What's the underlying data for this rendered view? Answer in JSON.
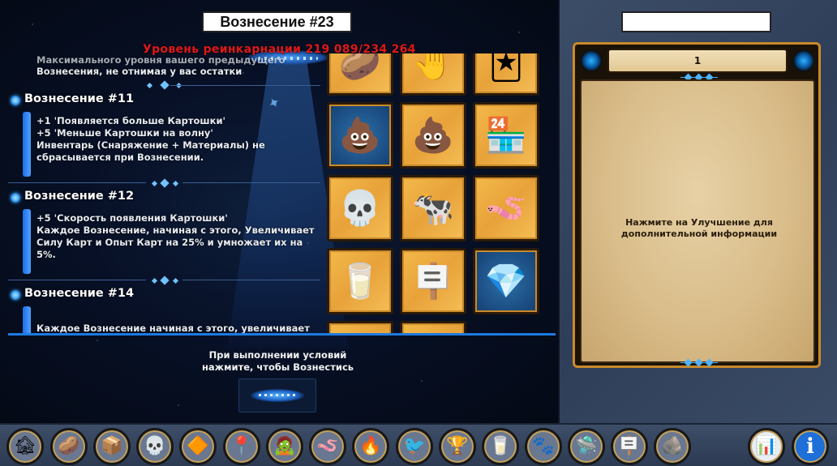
{
  "title": "Вознесение #23",
  "reincarnation_level": "Уровень реинкарнации 219 089/234 264",
  "ascensions": {
    "cut_text": [
      "Максимального уровня вашего предыдущего",
      "Вознесения, не отнимая у вас остатки"
    ],
    "items": [
      {
        "title": "Вознесение #11",
        "lines": [
          "+1 'Появляется больше Картошки'",
          "+5 'Меньше Картошки на волну'",
          "Инвентарь (Снаряжение + Материалы) не",
          "сбрасывается при Вознесении."
        ]
      },
      {
        "title": "Вознесение #12",
        "lines": [
          "+5 'Скорость появления Картошки'",
          "Каждое Вознесение, начиная с этого, Увеличивает",
          "Силу Карт и Опыт Карт на 25% и умножает их на",
          "5%."
        ]
      },
      {
        "title": "Вознесение #14",
        "lines": [
          "Каждое Вознесение начиная с этого, увеличивает"
        ]
      }
    ]
  },
  "ascend_prompt": [
    "При выполнении условий",
    "нажмите, чтобы Вознестись"
  ],
  "upgrades": [
    {
      "icon": "potato-icon",
      "glyph": "🥔",
      "style": "gold"
    },
    {
      "icon": "worm-hand-icon",
      "glyph": "🤚",
      "style": "gold"
    },
    {
      "icon": "cards-icon",
      "glyph": "🃏",
      "style": "gold"
    },
    {
      "icon": "poop-icon",
      "glyph": "💩",
      "style": "blue"
    },
    {
      "icon": "poop-pile-icon",
      "glyph": "💩",
      "style": "gold"
    },
    {
      "icon": "shop-gear-icon",
      "glyph": "🏪",
      "style": "gold"
    },
    {
      "icon": "skull-icon",
      "glyph": "💀",
      "style": "gold"
    },
    {
      "icon": "cow-icon",
      "glyph": "🐄",
      "style": "gold"
    },
    {
      "icon": "worm-icon",
      "glyph": "🪱",
      "style": "gold"
    },
    {
      "icon": "timer-milk-icon",
      "glyph": "🥛",
      "style": "gold"
    },
    {
      "icon": "signpost-icon",
      "glyph": "🪧",
      "style": "gold"
    },
    {
      "icon": "crystal-icon",
      "glyph": "💎",
      "style": "blue"
    }
  ],
  "detail": {
    "search_value": "",
    "page": "1",
    "info": "Нажмите на Улучшение для дополнительной информации"
  },
  "toolbar": [
    {
      "icon": "farm-icon",
      "glyph": "🏚"
    },
    {
      "icon": "potato-icon",
      "glyph": "🥔"
    },
    {
      "icon": "crate-icon",
      "glyph": "📦"
    },
    {
      "icon": "skull-icon",
      "glyph": "💀"
    },
    {
      "icon": "diamond-card-icon",
      "glyph": "🔶"
    },
    {
      "icon": "map-pin-icon",
      "glyph": "📍"
    },
    {
      "icon": "potato-figure-icon",
      "glyph": "🧟"
    },
    {
      "icon": "worm-icon",
      "glyph": "🪱"
    },
    {
      "icon": "fire-orb-icon",
      "glyph": "🔥"
    },
    {
      "icon": "phoenix-icon",
      "glyph": "🐦"
    },
    {
      "icon": "trophy-icon",
      "glyph": "🏆"
    },
    {
      "icon": "milk-icon",
      "glyph": "🥛"
    },
    {
      "icon": "paw-icon",
      "glyph": "🐾"
    },
    {
      "icon": "ufo-icon",
      "glyph": "🛸"
    },
    {
      "icon": "signpost-icon",
      "glyph": "🪧"
    },
    {
      "icon": "rock-icon",
      "glyph": "🪨"
    },
    {
      "icon": "stats-icon",
      "glyph": "📊"
    },
    {
      "icon": "info-icon",
      "glyph": "ℹ"
    }
  ],
  "colors": {
    "reincarnation_red": "#e01818",
    "accent_blue": "#1d7ae0",
    "tile_gold": "#f3b94a",
    "parchment": "#e7d1a6"
  }
}
